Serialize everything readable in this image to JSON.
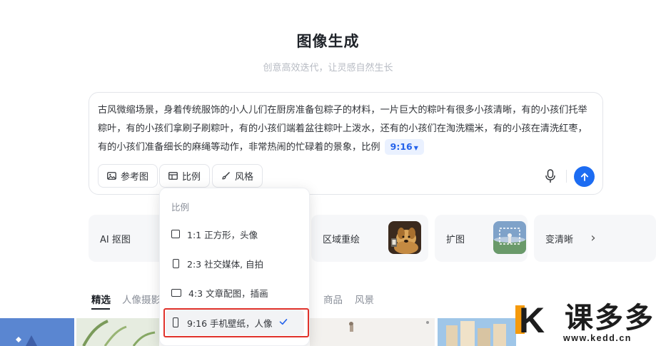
{
  "header": {
    "title": "图像生成",
    "subtitle": "创意高效迭代，让灵感自然生长"
  },
  "prompt": {
    "text": "古风微缩场景，身着传统服饰的小人儿们在厨房准备包粽子的材料，一片巨大的粽叶有很多小孩清晰，有的小孩们托举粽叶，有的小孩们拿刷子刷粽叶，有的小孩们端着盆往粽叶上泼水，还有的小孩们在淘洗糯米，有的小孩在清洗红枣，有的小孩们准备细长的麻绳等动作，非常热闹的忙碌着的景象，比例",
    "ratio_chip": "9:16",
    "tools": {
      "reference_label": "参考图",
      "ratio_label": "比例",
      "style_label": "风格"
    }
  },
  "features": [
    {
      "label": "AI 抠图"
    },
    {
      "label": "区域重绘"
    },
    {
      "label": "扩图"
    },
    {
      "label": "变清晰"
    }
  ],
  "categories": [
    "精选",
    "人像摄影",
    "",
    "商品",
    "风景"
  ],
  "categories_partial": "",
  "ratio_menu": {
    "header": "比例",
    "options": [
      {
        "label": "1:1 正方形，头像",
        "shape": "square"
      },
      {
        "label": "2:3 社交媒体, 自拍",
        "shape": "portrait"
      },
      {
        "label": "4:3 文章配图，插画",
        "shape": "landscape"
      },
      {
        "label": "9:16 手机壁纸，人像",
        "shape": "tall",
        "selected": true
      }
    ]
  },
  "watermark": {
    "brand": "课多多",
    "url": "www.kedd.cn"
  },
  "colors": {
    "accent": "#1c6cf2",
    "highlight_border": "#e0322b",
    "watermark_orange": "#f59a0c"
  }
}
